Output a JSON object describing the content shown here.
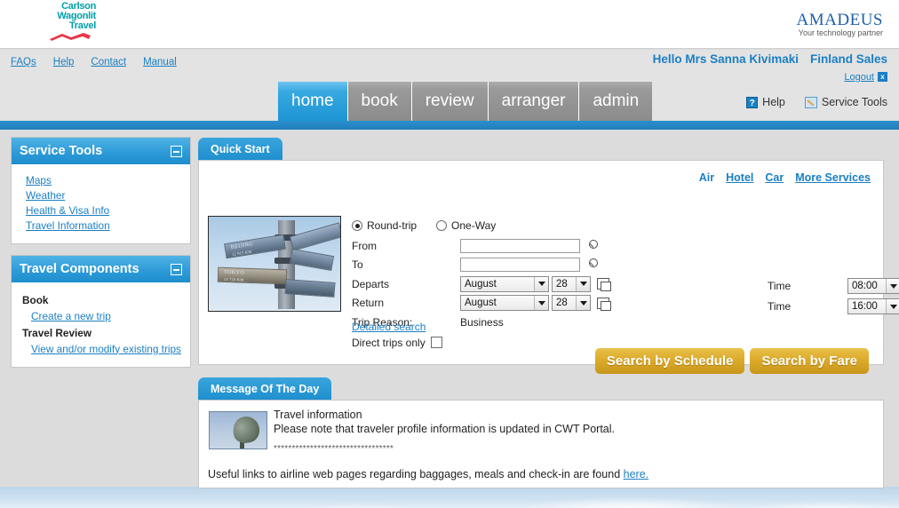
{
  "header": {
    "cwt_logo": {
      "line1": "Carlson",
      "line2": "Wagonlit",
      "line3": "Travel"
    },
    "amadeus_logo": {
      "word": "amadeus",
      "tagline": "Your technology partner"
    }
  },
  "utility": {
    "links": [
      {
        "label": "FAQs",
        "name": "faqs-link"
      },
      {
        "label": "Help",
        "name": "help-link"
      },
      {
        "label": "Contact",
        "name": "contact-link"
      },
      {
        "label": "Manual",
        "name": "manual-link"
      }
    ],
    "greeting": "Hello Mrs Sanna Kivimaki",
    "organisation": "Finland Sales",
    "logout_label": "Logout",
    "logout_badge": "x"
  },
  "nav": {
    "tabs": [
      {
        "label": "home",
        "active": true
      },
      {
        "label": "book",
        "active": false
      },
      {
        "label": "review",
        "active": false
      },
      {
        "label": "arranger",
        "active": false
      },
      {
        "label": "admin",
        "active": false
      }
    ],
    "help_label": "Help",
    "help_icon_glyph": "?",
    "service_tools_label": "Service Tools"
  },
  "sidebar": {
    "panels": [
      {
        "title": "Service Tools",
        "links": [
          {
            "label": "Maps"
          },
          {
            "label": "Weather"
          },
          {
            "label": "Health & Visa Info"
          },
          {
            "label": "Travel Information"
          }
        ]
      },
      {
        "title": "Travel Components",
        "groups": [
          {
            "label": "Book",
            "links": [
              {
                "label": "Create a new trip"
              }
            ]
          },
          {
            "label": "Travel Review",
            "links": [
              {
                "label": "View and/or modify existing trips"
              }
            ]
          }
        ]
      }
    ]
  },
  "quickstart": {
    "tab_label": "Quick Start",
    "service_links": [
      {
        "label": "Air",
        "current": true
      },
      {
        "label": "Hotel",
        "current": false
      },
      {
        "label": "Car",
        "current": false
      },
      {
        "label": "More Services",
        "current": false
      }
    ],
    "trip_type": {
      "roundtrip_label": "Round-trip",
      "oneway_label": "One-Way",
      "selected": "Round-trip"
    },
    "fields": {
      "from_label": "From",
      "from_value": "",
      "to_label": "To",
      "to_value": "",
      "departs_label": "Departs",
      "departs_month": "August",
      "departs_day": "28",
      "return_label": "Return",
      "return_month": "August",
      "return_day": "28",
      "trip_reason_label": "Trip Reason:",
      "trip_reason_value": "Business",
      "direct_trips_label": "Direct trips only",
      "direct_trips_checked": false
    },
    "time": {
      "depart_time_label": "Time",
      "depart_time_value": "08:00",
      "return_time_label": "Time",
      "return_time_value": "16:00"
    },
    "detailed_search_label": "Detailed search",
    "buttons": {
      "schedule": "Search by Schedule",
      "fare": "Search by Fare"
    }
  },
  "motd": {
    "tab_label": "Message Of The Day",
    "title": "Travel information",
    "subtitle": "Please note that traveler profile information is updated in CWT Portal.",
    "separator": "*********************************",
    "footer_text": "Useful links to airline web pages regarding baggages, meals and check-in are found ",
    "footer_link": "here."
  },
  "colors": {
    "brand_blue": "#1e8ecd",
    "link_blue": "#1b7fc4",
    "cwt_teal": "#00a0a8",
    "cwt_red": "#e8374a",
    "amadeus_blue": "#1e5fa8",
    "gold": "#ddab2b",
    "page_bg": "#dcdcdc",
    "nav_inactive": "#8c8c8c"
  }
}
